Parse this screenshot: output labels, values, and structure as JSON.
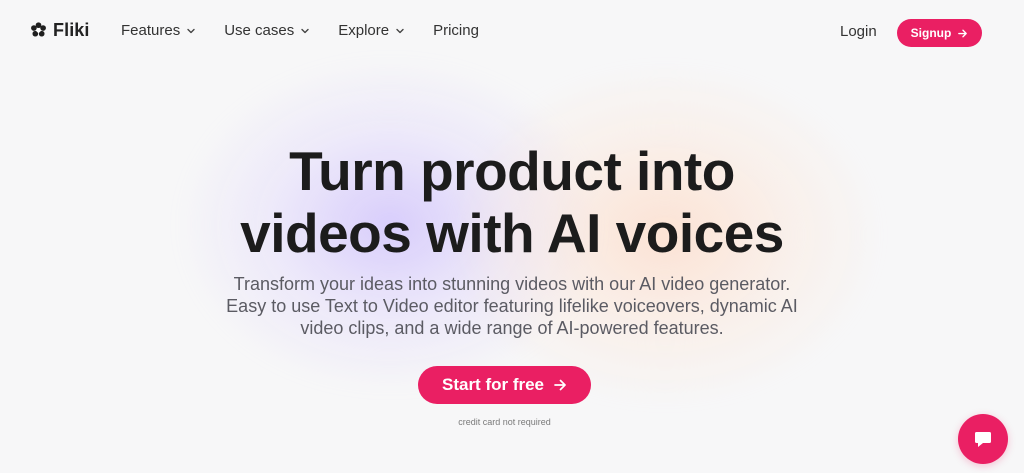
{
  "nav": {
    "logo_text": "Fliki",
    "items": [
      {
        "label": "Features",
        "has_dropdown": true
      },
      {
        "label": "Use cases",
        "has_dropdown": true
      },
      {
        "label": "Explore",
        "has_dropdown": true
      },
      {
        "label": "Pricing",
        "has_dropdown": false
      }
    ],
    "login_label": "Login",
    "signup_label": "Signup"
  },
  "hero": {
    "title_line_1": "Turn product into",
    "title_line_2": "videos with AI voices",
    "subtitle_line_1": "Transform your ideas into stunning videos with our AI video generator.",
    "subtitle_line_2": "Easy to use Text to Video editor featuring lifelike voiceovers, dynamic AI",
    "subtitle_line_3": "video clips, and a wide range of AI-powered features.",
    "cta_label": "Start for free",
    "note": "credit card not required"
  },
  "icons": {
    "logo": "flower-logo-icon",
    "dropdown": "chevron-down-icon",
    "arrow": "arrow-right-icon",
    "chat": "chat-bubble-icon"
  },
  "colors": {
    "accent": "#EA1F63",
    "text": "#1C1C1C",
    "muted": "#5B5B63",
    "background": "#F7F7F8"
  }
}
